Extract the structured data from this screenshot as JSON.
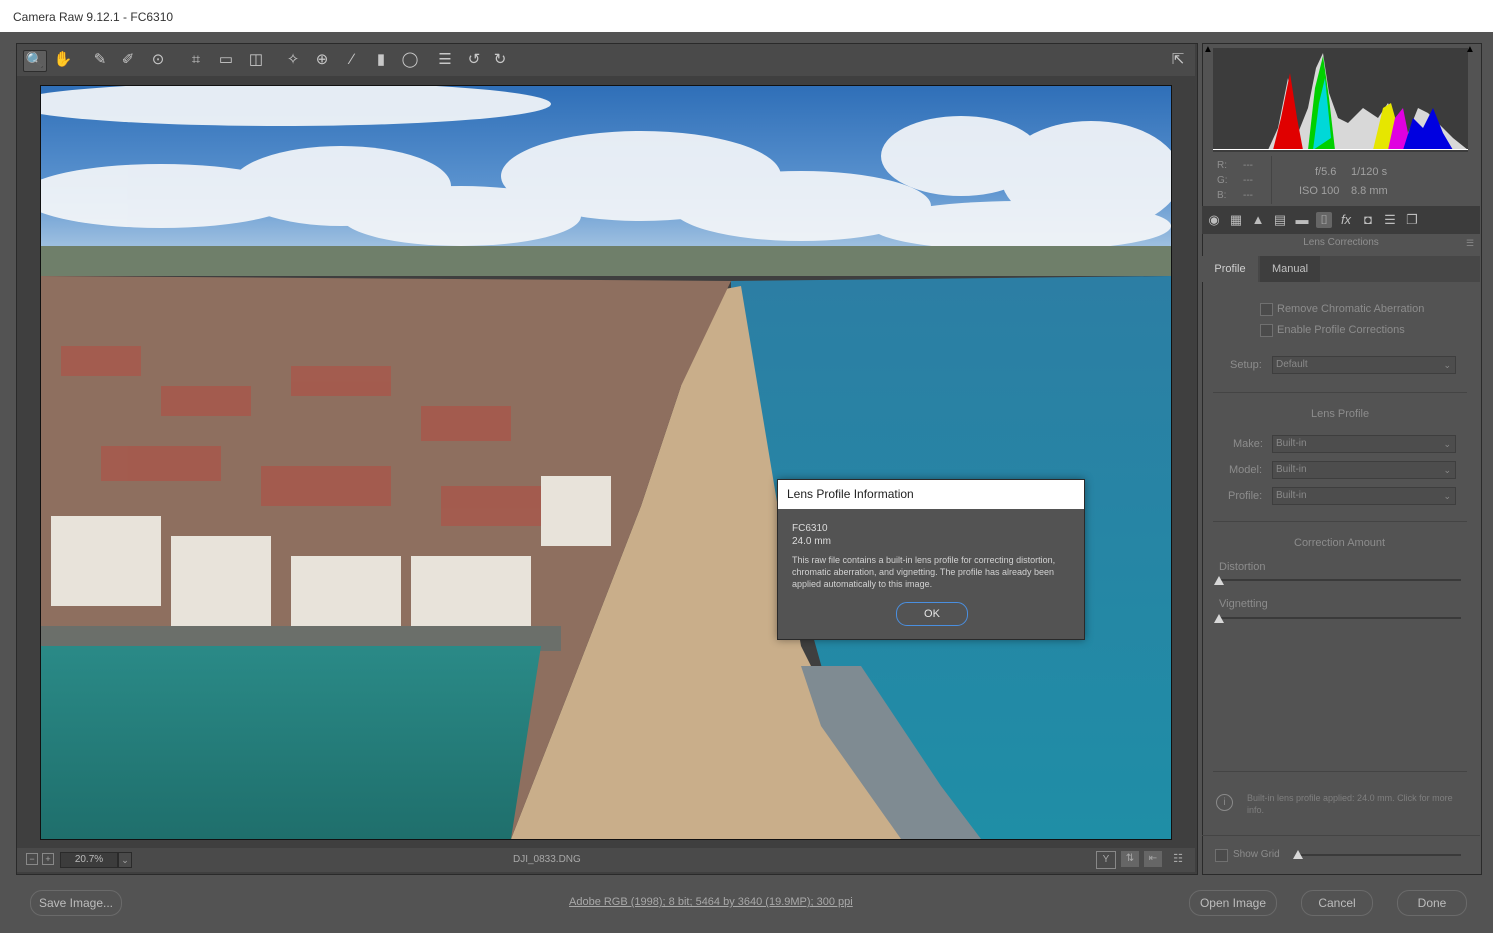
{
  "window": {
    "title": "Camera Raw 9.12.1  -  FC6310"
  },
  "toolbar": {
    "tools": [
      {
        "name": "zoom-tool-icon",
        "glyph": "🔍"
      },
      {
        "name": "hand-tool-icon",
        "glyph": "✋"
      },
      {
        "name": "white-balance-icon",
        "glyph": "✎"
      },
      {
        "name": "color-sampler-icon",
        "glyph": "✐"
      },
      {
        "name": "target-adjust-icon",
        "glyph": "⊙"
      },
      {
        "name": "crop-tool-icon",
        "glyph": "⌗"
      },
      {
        "name": "straighten-icon",
        "glyph": "▭"
      },
      {
        "name": "transform-icon",
        "glyph": "◫"
      },
      {
        "name": "spot-removal-icon",
        "glyph": "✧"
      },
      {
        "name": "red-eye-icon",
        "glyph": "⊕"
      },
      {
        "name": "adjustment-brush-icon",
        "glyph": "∕"
      },
      {
        "name": "graduated-filter-icon",
        "glyph": "▮"
      },
      {
        "name": "radial-filter-icon",
        "glyph": "◯"
      },
      {
        "name": "preferences-icon",
        "glyph": "☰"
      },
      {
        "name": "rotate-left-icon",
        "glyph": "↺"
      },
      {
        "name": "rotate-right-icon",
        "glyph": "↻"
      }
    ],
    "fullscreen_glyph": "⇱"
  },
  "preview": {
    "zoom": "20.7%",
    "filename": "DJI_0833.DNG"
  },
  "info": {
    "r_label": "R:",
    "r_value": "---",
    "g_label": "G:",
    "g_value": "---",
    "b_label": "B:",
    "b_value": "---",
    "aperture": "f/5.6",
    "shutter": "1/120 s",
    "iso": "ISO 100",
    "focal": "8.8 mm"
  },
  "panel": {
    "title": "Lens Corrections",
    "tabs": [
      "Profile",
      "Manual"
    ],
    "active_tab": "Profile",
    "remove_ca_label": "Remove Chromatic Aberration",
    "enable_profile_label": "Enable Profile Corrections",
    "setup_label": "Setup:",
    "setup_value": "Default",
    "lens_profile_header": "Lens Profile",
    "make_label": "Make:",
    "make_value": "Built-in",
    "model_label": "Model:",
    "model_value": "Built-in",
    "profile_label": "Profile:",
    "profile_value": "Built-in",
    "correction_header": "Correction Amount",
    "distortion_label": "Distortion",
    "vignetting_label": "Vignetting",
    "distortion_value": 0,
    "vignetting_value": 0,
    "builtin_note": "Built-in lens profile applied: 24.0 mm.  Click for more info.",
    "show_grid_label": "Show Grid"
  },
  "dialog": {
    "title": "Lens Profile Information",
    "camera": "FC6310",
    "focal": "24.0 mm",
    "message": "This raw file contains a built-in lens profile for correcting distortion, chromatic aberration, and vignetting. The profile has already been applied automatically to this image.",
    "ok_label": "OK"
  },
  "footer": {
    "save_label": "Save Image...",
    "workflow_link": "Adobe RGB (1998); 8 bit; 5464 by 3640 (19.9MP); 300 ppi",
    "open_label": "Open Image",
    "cancel_label": "Cancel",
    "done_label": "Done"
  },
  "colors": {
    "dialog_ok_border": "#4a8fe0",
    "panel_bg": "#535353"
  }
}
